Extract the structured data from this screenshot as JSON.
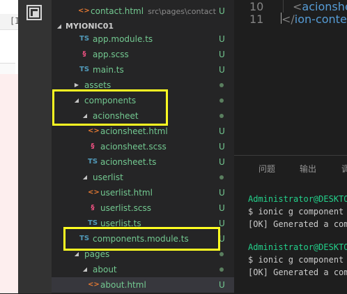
{
  "explorer": {
    "rows": [
      {
        "label": "contact.html",
        "path": "src\\pages\\contact",
        "icon": "html-icon",
        "badge": "U",
        "color": "green"
      },
      {
        "label": "MYIONIC01",
        "section": true
      },
      {
        "label": "app.module.ts",
        "icon": "ts-icon",
        "badge": "U",
        "color": "green"
      },
      {
        "label": "app.scss",
        "icon": "scss-icon",
        "badge": "U",
        "color": "green"
      },
      {
        "label": "main.ts",
        "icon": "ts-icon",
        "badge": "U",
        "color": "green"
      },
      {
        "label": "assets",
        "folder": "collapsed",
        "badge": "dot",
        "color": "green"
      },
      {
        "label": "components",
        "folder": "expanded",
        "badge": "dot",
        "color": "green"
      },
      {
        "label": "acionsheet",
        "folder": "expanded",
        "badge": "dot",
        "color": "green"
      },
      {
        "label": "acionsheet.html",
        "icon": "html-icon",
        "badge": "U",
        "color": "green"
      },
      {
        "label": "acionsheet.scss",
        "icon": "scss-icon",
        "badge": "U",
        "color": "green"
      },
      {
        "label": "acionsheet.ts",
        "icon": "ts-icon",
        "badge": "U",
        "color": "green"
      },
      {
        "label": "userlist",
        "folder": "expanded",
        "badge": "dot",
        "color": "green"
      },
      {
        "label": "userlist.html",
        "icon": "html-icon",
        "badge": "U",
        "color": "green"
      },
      {
        "label": "userlist.scss",
        "icon": "scss-icon",
        "badge": "U",
        "color": "green"
      },
      {
        "label": "userlist.ts",
        "icon": "ts-icon",
        "badge": "U",
        "color": "green"
      },
      {
        "label": "components.module.ts",
        "icon": "ts-icon",
        "badge": "U",
        "color": "green"
      },
      {
        "label": "pages",
        "folder": "expanded",
        "badge": "dot",
        "color": "green"
      },
      {
        "label": "about",
        "folder": "expanded",
        "badge": "dot",
        "color": "green"
      },
      {
        "label": "about.html",
        "icon": "html-icon",
        "badge": "U",
        "color": "green",
        "active": true
      }
    ]
  },
  "editor": {
    "lines": [
      {
        "num": "10",
        "text": "<acionsheet",
        "tag": "acionsheet",
        "open": "<"
      },
      {
        "num": "11",
        "text": "</ion-content",
        "tag": "ion-content",
        "open": "</"
      }
    ]
  },
  "panel": {
    "tabs": [
      "问题",
      "输出",
      "调"
    ]
  },
  "terminal": {
    "lines": [
      {
        "text": "Administrator@DESKTOP",
        "color": "green"
      },
      {
        "text": "$ ionic g component a",
        "color": "white"
      },
      {
        "text": "[OK] Generated a comp",
        "color": "white"
      },
      {
        "text": "",
        "color": "white"
      },
      {
        "text": "Administrator@DESKTOP",
        "color": "green"
      },
      {
        "text": "$ ionic g component u",
        "color": "white"
      },
      {
        "text": "[OK] Generated a comp",
        "color": "white"
      }
    ]
  },
  "left_stub": {
    "text": "[I"
  },
  "colors": {
    "highlight": "#ffff22",
    "git_untracked": "#73c991",
    "ts": "#519aba",
    "html": "#e37933",
    "scss": "#f55385"
  }
}
